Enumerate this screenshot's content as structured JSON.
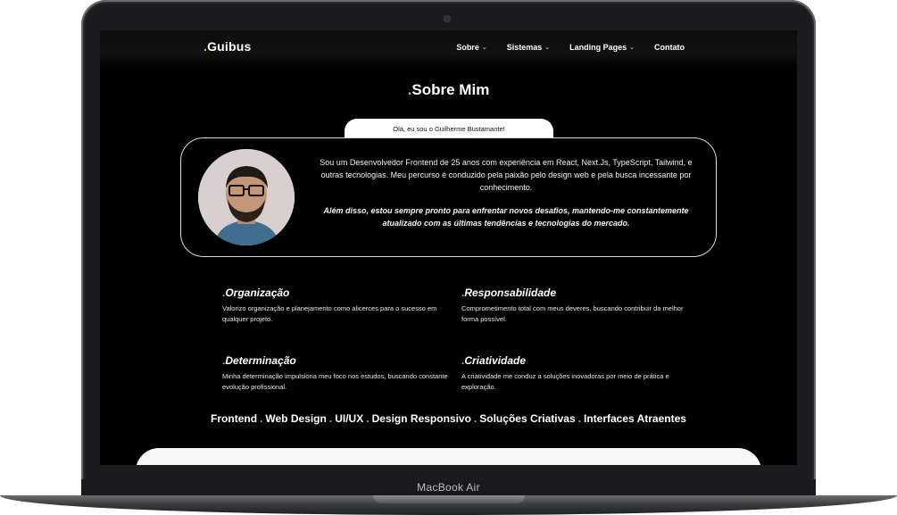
{
  "device": {
    "label": "MacBook Air"
  },
  "site": {
    "logo": {
      "prefix": ".",
      "name": "Guibus"
    },
    "nav": [
      {
        "label": "Sobre",
        "has_dropdown": true
      },
      {
        "label": "Sistemas",
        "has_dropdown": true
      },
      {
        "label": "Landing Pages",
        "has_dropdown": true
      },
      {
        "label": "Contato",
        "has_dropdown": false
      }
    ],
    "section_title": {
      "prefix": ".",
      "text": "Sobre Mim"
    },
    "intro_tab": "Olá, eu sou o Guilherme Bustamante!",
    "about": {
      "paragraph": "Sou um Desenvolvedor Frontend de 25 anos com experiência em React, Next.Js, TypeScript, Tailwind, e outras tecnologias. Meu percurso é conduzido pela paixão pelo design web e pela busca incessante por conhecimento.",
      "emphasis": "Além disso, estou sempre pronto para enfrentar novos desafios, mantendo-me constantemente atualizado com as últimas tendências e tecnologias do mercado."
    },
    "features": [
      {
        "title": "Organização",
        "text": "Valorizo organização e planejamento como alicerces para o sucesso em qualquer projeto."
      },
      {
        "title": "Responsabilidade",
        "text": "Comprometimento total com meus deveres, buscando contribuir da melhor forma possível."
      },
      {
        "title": "Determinação",
        "text": "Minha determinação impulsiona meu foco nos estudos, buscando constante evolução profissional."
      },
      {
        "title": "Criatividade",
        "text": "A criatividade me conduz a soluções inovadoras por meio de prática e exploração."
      }
    ],
    "skills": [
      "Frontend",
      "Web Design",
      "UI/UX",
      "Design Responsivo",
      "Soluções Criativas",
      "Interfaces Atraentes"
    ],
    "skills_separator": ".",
    "colors": {
      "accent": "#8bd43c",
      "background": "#000000",
      "text": "#ffffff"
    }
  }
}
